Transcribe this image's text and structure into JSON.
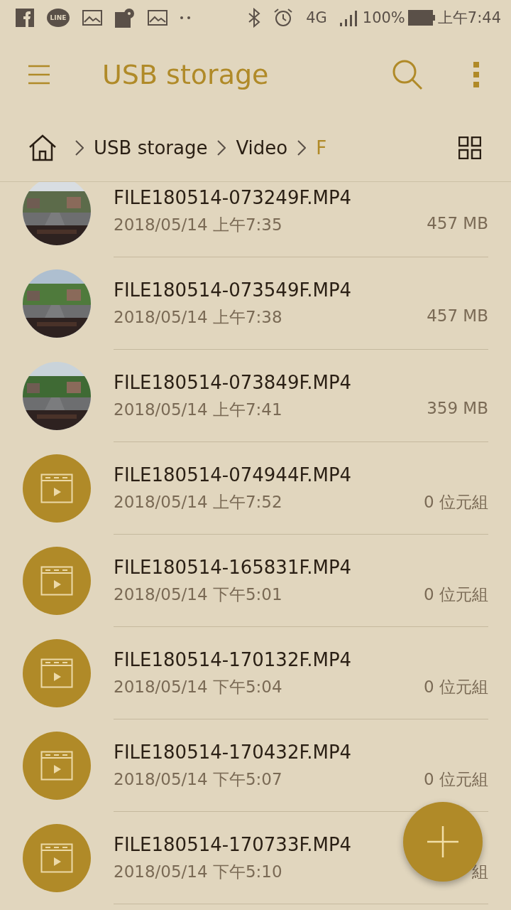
{
  "status_bar": {
    "line_label": "LINE",
    "network": "4G",
    "battery": "100%",
    "time": "上午7:44"
  },
  "app_bar": {
    "title": "USB storage"
  },
  "breadcrumb": [
    {
      "label": "USB storage",
      "selected": false
    },
    {
      "label": "Video",
      "selected": false
    },
    {
      "label": "F",
      "selected": true
    }
  ],
  "files": [
    {
      "name": "FILE180514-073249F.MP4",
      "date": "2018/05/14 上午7:35",
      "size": "457 MB",
      "kind": "picture"
    },
    {
      "name": "FILE180514-073549F.MP4",
      "date": "2018/05/14 上午7:38",
      "size": "457 MB",
      "kind": "picture"
    },
    {
      "name": "FILE180514-073849F.MP4",
      "date": "2018/05/14 上午7:41",
      "size": "359 MB",
      "kind": "picture"
    },
    {
      "name": "FILE180514-074944F.MP4",
      "date": "2018/05/14 上午7:52",
      "size": "0 位元組",
      "kind": "video"
    },
    {
      "name": "FILE180514-165831F.MP4",
      "date": "2018/05/14 下午5:01",
      "size": "0 位元組",
      "kind": "video"
    },
    {
      "name": "FILE180514-170132F.MP4",
      "date": "2018/05/14 下午5:04",
      "size": "0 位元組",
      "kind": "video"
    },
    {
      "name": "FILE180514-170432F.MP4",
      "date": "2018/05/14 下午5:07",
      "size": "0 位元組",
      "kind": "video"
    },
    {
      "name": "FILE180514-170733F.MP4",
      "date": "2018/05/14 下午5:10",
      "size": "組",
      "kind": "video"
    }
  ]
}
